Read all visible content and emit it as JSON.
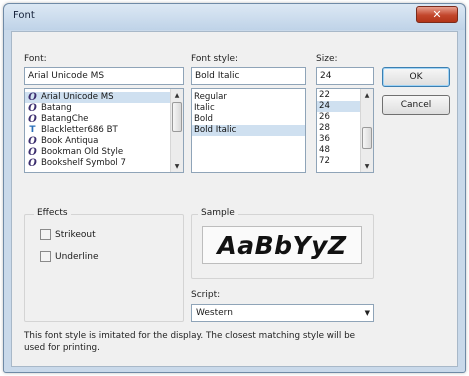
{
  "window": {
    "title": "Font",
    "close_glyph": "✕"
  },
  "font": {
    "label": "Font:",
    "value": "Arial Unicode MS",
    "items": [
      {
        "icon": "opentype-font-icon",
        "glyph": "O",
        "label": "Arial Unicode MS",
        "selected": true
      },
      {
        "icon": "opentype-font-icon",
        "glyph": "O",
        "label": "Batang"
      },
      {
        "icon": "opentype-font-icon",
        "glyph": "O",
        "label": "BatangChe"
      },
      {
        "icon": "truetype-font-icon",
        "glyph": "T",
        "label": "Blackletter686 BT"
      },
      {
        "icon": "opentype-font-icon",
        "glyph": "O",
        "label": "Book Antiqua"
      },
      {
        "icon": "opentype-font-icon",
        "glyph": "O",
        "label": "Bookman Old Style"
      },
      {
        "icon": "opentype-font-icon",
        "glyph": "O",
        "label": "Bookshelf Symbol 7"
      }
    ]
  },
  "style": {
    "label": "Font style:",
    "value": "Bold Italic",
    "items": [
      {
        "label": "Regular"
      },
      {
        "label": "Italic"
      },
      {
        "label": "Bold"
      },
      {
        "label": "Bold Italic",
        "selected": true
      }
    ]
  },
  "size": {
    "label": "Size:",
    "value": "24",
    "items": [
      {
        "label": "22"
      },
      {
        "label": "24",
        "selected": true
      },
      {
        "label": "26"
      },
      {
        "label": "28"
      },
      {
        "label": "36"
      },
      {
        "label": "48"
      },
      {
        "label": "72"
      }
    ]
  },
  "buttons": {
    "ok": "OK",
    "cancel": "Cancel"
  },
  "effects": {
    "title": "Effects",
    "strikeout": "Strikeout",
    "underline": "Underline"
  },
  "sample": {
    "title": "Sample",
    "text": "AaBbYyZ"
  },
  "script": {
    "label": "Script:",
    "value": "Western"
  },
  "note": "This font style is imitated for the display. The closest matching style will be used for printing.",
  "icons": {
    "scroll_up": "▲",
    "scroll_down": "▼",
    "dropdown": "▼"
  }
}
